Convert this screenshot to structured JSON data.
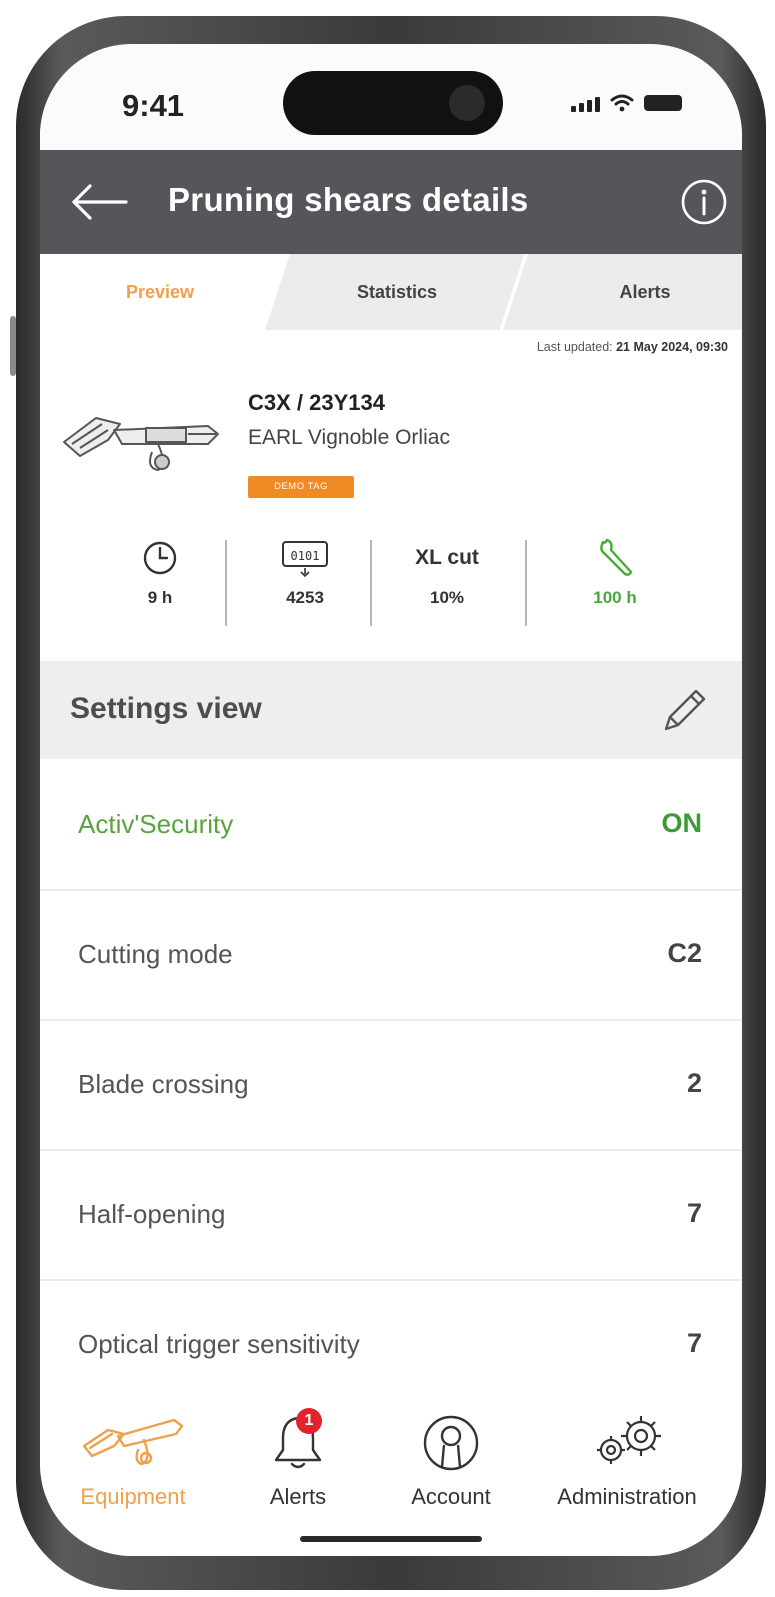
{
  "status_bar": {
    "time": "9:41"
  },
  "app_bar": {
    "title": "Pruning shears details"
  },
  "tabs": [
    {
      "label": "Preview",
      "active": true
    },
    {
      "label": "Statistics",
      "active": false
    },
    {
      "label": "Alerts",
      "active": false
    }
  ],
  "last_updated": {
    "label": "Last updated:",
    "value": "21 May 2024, 09:30"
  },
  "device": {
    "model": "C3X / 23Y134",
    "owner": "EARL Vignoble Orliac",
    "tag": "DEMO TAG",
    "image_icon": "pruning-shears-icon"
  },
  "stats": [
    {
      "icon": "clock-icon",
      "value": "9 h"
    },
    {
      "icon": "counter-icon",
      "value": "4253"
    },
    {
      "label": "XL cut",
      "value": "10%"
    },
    {
      "icon": "wrench-icon",
      "value": "100 h",
      "color": "#4aa83a"
    }
  ],
  "settings": {
    "title": "Settings view",
    "rows": [
      {
        "label": "Activ'Security",
        "value": "ON",
        "highlight": true
      },
      {
        "label": "Cutting mode",
        "value": "C2"
      },
      {
        "label": "Blade crossing",
        "value": "2"
      },
      {
        "label": "Half-opening",
        "value": "7"
      },
      {
        "label": "Optical trigger sensitivity",
        "value": "7"
      }
    ]
  },
  "nav": {
    "items": [
      {
        "label": "Equipment",
        "icon": "pruning-shears-icon",
        "active": true
      },
      {
        "label": "Alerts",
        "icon": "bell-icon",
        "badge": "1"
      },
      {
        "label": "Account",
        "icon": "user-icon"
      },
      {
        "label": "Administration",
        "icon": "gears-icon"
      }
    ]
  },
  "colors": {
    "accent": "#f0a04b",
    "app_bar": "#55565a",
    "success": "#4aa83a",
    "badge": "#e0242e",
    "tag": "#f08a24"
  }
}
